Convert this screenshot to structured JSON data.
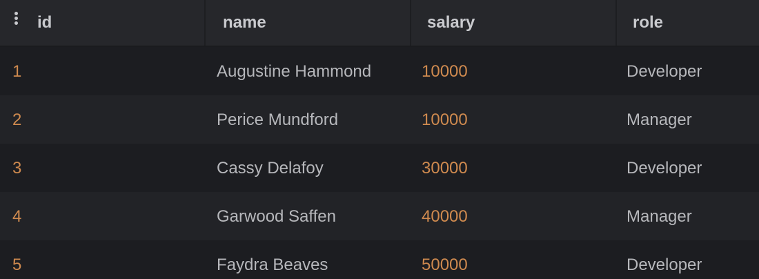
{
  "table": {
    "columns": [
      {
        "key": "id",
        "label": "id"
      },
      {
        "key": "name",
        "label": "name"
      },
      {
        "key": "salary",
        "label": "salary"
      },
      {
        "key": "role",
        "label": "role"
      }
    ],
    "rows": [
      {
        "id": "1",
        "name": "Augustine Hammond",
        "salary": "10000",
        "role": "Developer"
      },
      {
        "id": "2",
        "name": "Perice Mundford",
        "salary": "10000",
        "role": "Manager"
      },
      {
        "id": "3",
        "name": "Cassy Delafoy",
        "salary": "30000",
        "role": "Developer"
      },
      {
        "id": "4",
        "name": "Garwood Saffen",
        "salary": "40000",
        "role": "Manager"
      },
      {
        "id": "5",
        "name": "Faydra Beaves",
        "salary": "50000",
        "role": "Developer"
      }
    ],
    "menu_icon": "vertical-dots-icon"
  },
  "colors": {
    "background": "#1c1d21",
    "header_background": "#26272b",
    "number_text": "#cf8a4f",
    "plain_text": "#b6b7bb",
    "header_text": "#c9cace"
  }
}
